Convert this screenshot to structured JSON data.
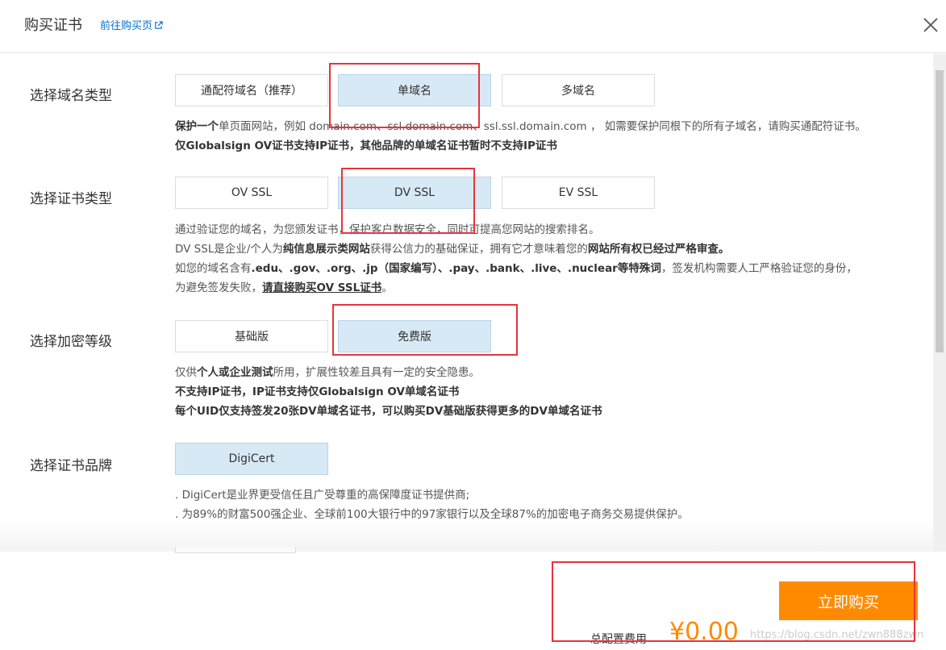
{
  "header": {
    "title": "购买证书",
    "link": "前往购买页"
  },
  "sections": {
    "domain": {
      "label": "选择域名类型",
      "options": [
        "通配符域名（推荐）",
        "单域名",
        "多域名"
      ],
      "selected": "单域名",
      "desc": {
        "l1_b": "保护一个",
        "l1_t": "单页面网站，例如 domain.com、ssl.domain.com、ssl.ssl.domain.com ， 如需要保护同根下的所有子域名，请购买通配符证书。",
        "l2_b": "仅Globalsign OV证书支持IP证书，其他品牌的单域名证书暂时不支持IP证书"
      }
    },
    "cert_type": {
      "label": "选择证书类型",
      "options": [
        "OV SSL",
        "DV SSL",
        "EV SSL"
      ],
      "selected": "DV SSL",
      "desc": {
        "l1": "通过验证您的域名，为您颁发证书，保护客户数据安全，同时可提高您网站的搜索排名。",
        "l2_a": "DV SSL是企业/个人为",
        "l2_b": "纯信息展示类网站",
        "l2_c": "获得公信力的基础保证，拥有它才意味着您的",
        "l2_d": "网站所有权已经过严格审查。",
        "l3_a": "如您的域名含有",
        "l3_b": ".edu、.gov、.org、.jp（国家编写）、.pay、.bank、.live、.nuclear等特殊词",
        "l3_c": "，签发机构需要人工严格验证您的身份，",
        "l4_a": "为避免签发失败，",
        "l4_b": "请直接购买OV SSL证书",
        "l4_c": "。"
      }
    },
    "encryption": {
      "label": "选择加密等级",
      "options": [
        "基础版",
        "免费版"
      ],
      "selected": "免费版",
      "desc": {
        "l1_a": "仅供",
        "l1_b": "个人或企业测试",
        "l1_c": "所用，扩展性较差且具有一定的安全隐患。",
        "l2": "不支持IP证书，IP证书支持仅Globalsign OV单域名证书",
        "l3": "每个UID仅支持签发20张DV单域名证书，可以购买DV基础版获得更多的DV单域名证书"
      }
    },
    "brand": {
      "label": "选择证书品牌",
      "options": [
        "DigiCert"
      ],
      "selected": "DigiCert",
      "desc": {
        "l1": ". DigiCert是业界更受信任且广受尊重的高保障度证书提供商;",
        "l2": ". 为89%的财富500强企业、全球前100大银行中的97家银行以及全球87%的加密电子商务交易提供保护。"
      }
    }
  },
  "footer": {
    "buy_label": "立即购买",
    "total_label": "总配置费用",
    "total_price": "¥0.00",
    "watermark": "https://blog.csdn.net/zwn888zwn"
  },
  "colors": {
    "accent": "#ff8a00",
    "link": "#0070cc",
    "selected_bg": "#d8e9f6",
    "highlight": "#e8333b"
  }
}
